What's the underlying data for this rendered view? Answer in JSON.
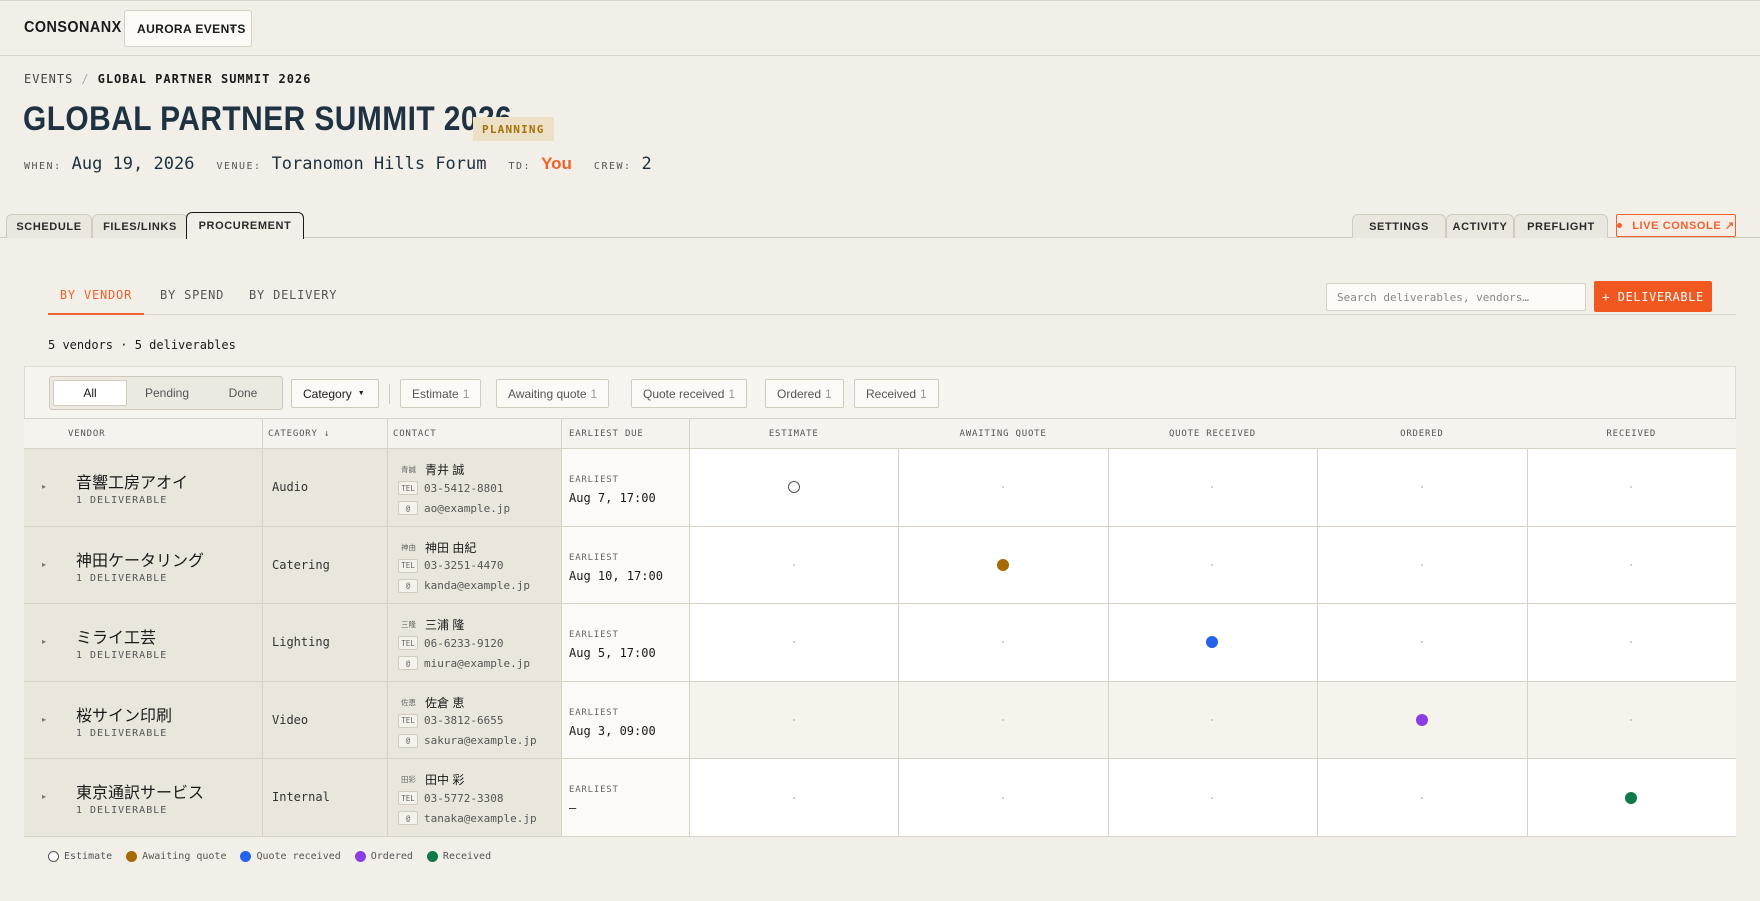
{
  "app": {
    "brand": "CONSONANX",
    "workspace": "AURORA EVENTS"
  },
  "breadcrumb": [
    "EVENTS",
    "GLOBAL PARTNER SUMMIT 2026"
  ],
  "event": {
    "title": "GLOBAL PARTNER SUMMIT 2026",
    "status": "PLANNING",
    "when_label": "WHEN:",
    "when": "Aug 19, 2026",
    "venue_label": "VENUE:",
    "venue": "Toranomon Hills Forum",
    "td_label": "TD:",
    "td": "You",
    "crew_label": "CREW:",
    "crew": "2"
  },
  "tabs": {
    "left": [
      "SCHEDULE",
      "FILES/LINKS",
      "PROCUREMENT"
    ],
    "active": "PROCUREMENT",
    "right": [
      "SETTINGS",
      "ACTIVITY",
      "PREFLIGHT"
    ],
    "live": "LIVE CONSOLE ↗"
  },
  "procurement": {
    "subtabs": [
      "BY VENDOR",
      "BY SPEND",
      "BY DELIVERY"
    ],
    "active_subtab": "BY VENDOR",
    "search_placeholder": "Search deliverables, vendors…",
    "add_button": "+ DELIVERABLE",
    "count": "5 vendors · 5 deliverables",
    "filters": {
      "segments": [
        "All",
        "Pending",
        "Done"
      ],
      "active_segment": "All",
      "category": "Category",
      "chips": [
        {
          "label": "Estimate",
          "n": "1"
        },
        {
          "label": "Awaiting quote",
          "n": "1"
        },
        {
          "label": "Quote received",
          "n": "1"
        },
        {
          "label": "Ordered",
          "n": "1"
        },
        {
          "label": "Received",
          "n": "1"
        }
      ]
    },
    "columns": {
      "vendor": "VENDOR",
      "category": "CATEGORY ↓",
      "contact": "CONTACT",
      "due": "EARLIEST DUE",
      "stages": [
        "ESTIMATE",
        "AWAITING QUOTE",
        "QUOTE RECEIVED",
        "ORDERED",
        "RECEIVED"
      ]
    },
    "stage_colors": [
      "#ffffff",
      "#a66a00",
      "#2563eb",
      "#8b3ee6",
      "#0e7a4a"
    ],
    "rows": [
      {
        "vendor": "音響工房アオイ",
        "sub": "1 DELIVERABLE",
        "category": "Audio",
        "contact_badge": "青誠",
        "contact_name": "青井 誠",
        "tel_label": "TEL",
        "tel": "03-5412-8801",
        "email_label": "@",
        "email": "ao@example.jp",
        "due_label": "EARLIEST",
        "due": "Aug 7, 17:00",
        "stage": 0
      },
      {
        "vendor": "神田ケータリング",
        "sub": "1 DELIVERABLE",
        "category": "Catering",
        "contact_badge": "神由",
        "contact_name": "神田 由紀",
        "tel_label": "TEL",
        "tel": "03-3251-4470",
        "email_label": "@",
        "email": "kanda@example.jp",
        "due_label": "EARLIEST",
        "due": "Aug 10, 17:00",
        "stage": 1
      },
      {
        "vendor": "ミライ工芸",
        "sub": "1 DELIVERABLE",
        "category": "Lighting",
        "contact_badge": "三隆",
        "contact_name": "三浦 隆",
        "tel_label": "TEL",
        "tel": "06-6233-9120",
        "email_label": "@",
        "email": "miura@example.jp",
        "due_label": "EARLIEST",
        "due": "Aug 5, 17:00",
        "stage": 2
      },
      {
        "vendor": "桜サイン印刷",
        "sub": "1 DELIVERABLE",
        "category": "Video",
        "contact_badge": "佐恵",
        "contact_name": "佐倉 恵",
        "tel_label": "TEL",
        "tel": "03-3812-6655",
        "email_label": "@",
        "email": "sakura@example.jp",
        "due_label": "EARLIEST",
        "due": "Aug 3, 09:00",
        "stage": 3
      },
      {
        "vendor": "東京通訳サービス",
        "sub": "1 DELIVERABLE",
        "category": "Internal",
        "contact_badge": "田彩",
        "contact_name": "田中 彩",
        "tel_label": "TEL",
        "tel": "03-5772-3308",
        "email_label": "@",
        "email": "tanaka@example.jp",
        "due_label": "EARLIEST",
        "due": "—",
        "stage": 4
      }
    ],
    "legend": [
      "Estimate",
      "Awaiting quote",
      "Quote received",
      "Ordered",
      "Received"
    ]
  }
}
